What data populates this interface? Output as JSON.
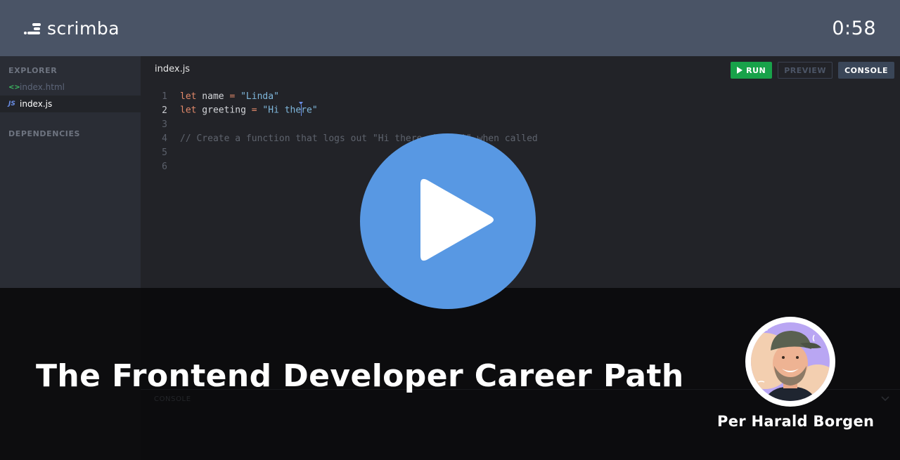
{
  "header": {
    "brand": "scrimba",
    "timer": "0:58"
  },
  "sidebar": {
    "explorer_heading": "EXPLORER",
    "files": [
      {
        "name": "index.html",
        "icon": "html-code-icon",
        "icon_glyph": "<>"
      },
      {
        "name": "index.js",
        "icon": "js-file-icon",
        "icon_glyph": "JS",
        "active": true
      }
    ],
    "dependencies_heading": "DEPENDENCIES"
  },
  "editor": {
    "tab_label": "index.js",
    "toolbar": {
      "run_label": "RUN",
      "preview_label": "PREVIEW",
      "console_label": "CONSOLE"
    },
    "lines": [
      {
        "number": "1",
        "kw": "let",
        "ident": " name ",
        "op": "=",
        "str": " \"Linda\"",
        "comment": ""
      },
      {
        "number": "2",
        "kw": "let",
        "ident": " greeting ",
        "op": "=",
        "str_before_cursor": " \"Hi the",
        "str_after_cursor": "re\"",
        "comment": ""
      },
      {
        "number": "3",
        "comment": ""
      },
      {
        "number": "4",
        "comment": "// Create a function that logs out \"Hi there, Linda!\" when called"
      },
      {
        "number": "5",
        "comment": ""
      },
      {
        "number": "6",
        "comment": ""
      }
    ],
    "active_line": "2"
  },
  "console": {
    "label": "CONSOLE"
  },
  "overlay": {
    "course_title": "The Frontend Developer Career Path",
    "instructor_name": "Per Harald Borgen"
  },
  "colors": {
    "header_bg": "#4a5466",
    "run_green": "#18a24a",
    "play_blue": "#5898e3",
    "keyword": "#e2896a",
    "string": "#7fb7dc"
  }
}
